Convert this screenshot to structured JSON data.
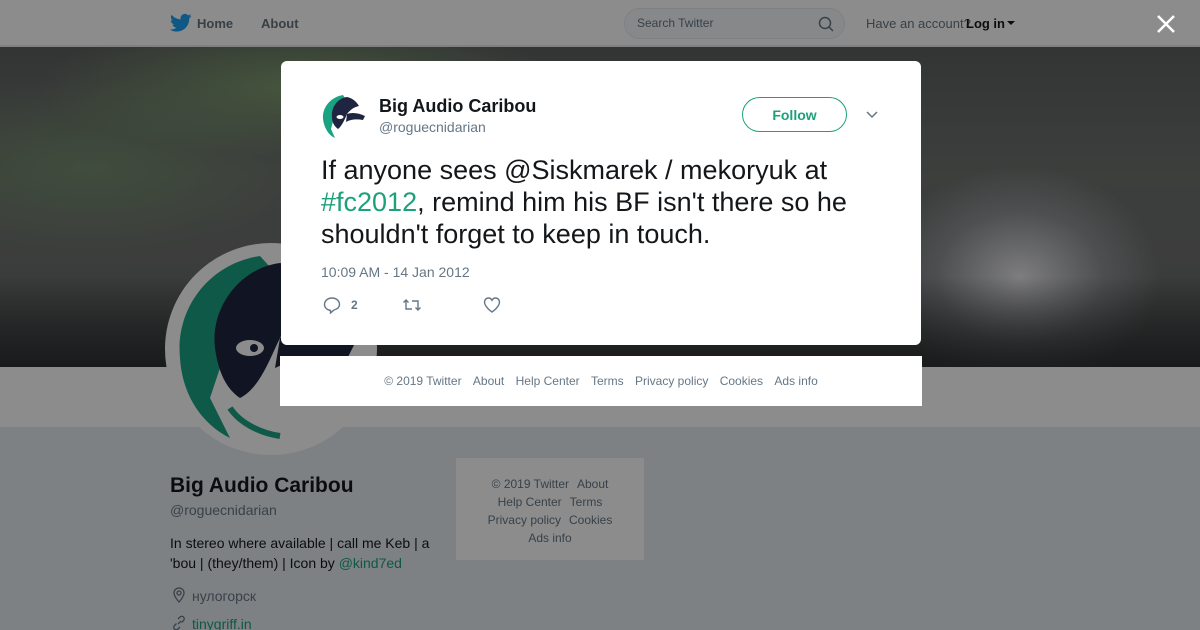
{
  "nav": {
    "home_label": "Home",
    "about_label": "About",
    "search_placeholder": "Search Twitter",
    "have_account": "Have an account?",
    "login_label": "Log in"
  },
  "profile": {
    "name": "Big Audio Caribou",
    "handle": "@roguecnidarian",
    "bio_text": "In stereo where available | call me Keb | a 'bou | (they/them) | Icon by ",
    "bio_mention": "@kind7ed",
    "location": "нулогорск",
    "website": "tinygriff.in"
  },
  "side_footer": {
    "copyright": "© 2019 Twitter",
    "about": "About",
    "help": "Help Center",
    "terms": "Terms",
    "privacy": "Privacy policy",
    "cookies": "Cookies",
    "ads": "Ads info"
  },
  "tweet": {
    "author_name": "Big Audio Caribou",
    "author_handle": "@roguecnidarian",
    "follow_label": "Follow",
    "text_before": "If anyone sees @Siskmarek / mekoryuk at ",
    "hashtag": "#fc2012",
    "text_after": ", remind him his BF isn't there so he shouldn't forget to keep in touch.",
    "timestamp": "10:09 AM - 14 Jan 2012",
    "reply_count": "2"
  },
  "modal_footer": {
    "copyright": "© 2019 Twitter",
    "about": "About",
    "help": "Help Center",
    "terms": "Terms",
    "privacy": "Privacy policy",
    "cookies": "Cookies",
    "ads": "Ads info"
  },
  "colors": {
    "accent": "#1da17a",
    "text_secondary": "#657786"
  },
  "icons": [
    "twitter-bird-icon",
    "search-icon",
    "close-icon",
    "location-icon",
    "link-icon",
    "chevron-down-icon",
    "reply-icon",
    "retweet-icon",
    "like-icon"
  ]
}
